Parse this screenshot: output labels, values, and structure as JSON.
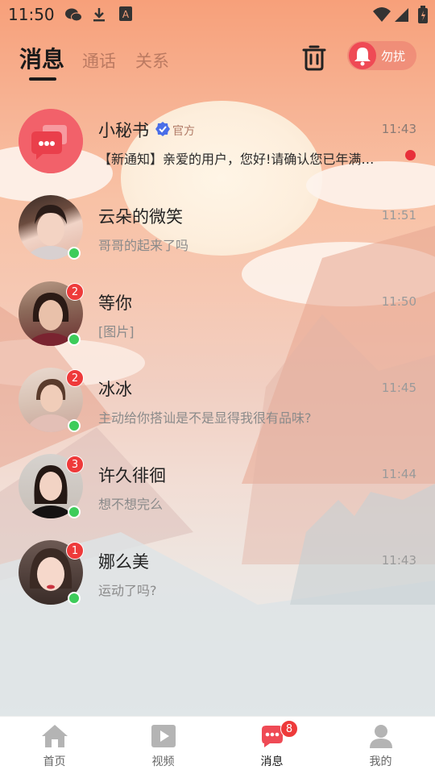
{
  "status_bar": {
    "time": "11:50",
    "icons": [
      "wechat-icon",
      "download-icon",
      "a-icon",
      "wifi-icon",
      "signal-icon",
      "battery-icon"
    ]
  },
  "header": {
    "tabs": [
      {
        "label": "消息",
        "active": true
      },
      {
        "label": "通话",
        "active": false
      },
      {
        "label": "关系",
        "active": false
      }
    ],
    "dnd_label": "勿扰"
  },
  "conversations": [
    {
      "name": "小秘书",
      "verified": true,
      "tag": "官方",
      "time": "11:43",
      "preview": "【新通知】亲爱的用户，您好!请确认您已年满…",
      "unread_dot": true,
      "badge": null,
      "online": false
    },
    {
      "name": "云朵的微笑",
      "time": "11:51",
      "preview": "哥哥的起来了吗",
      "badge": null,
      "online": true
    },
    {
      "name": "等你",
      "time": "11:50",
      "preview": "[图片]",
      "badge": "2",
      "online": true
    },
    {
      "name": "冰冰",
      "time": "11:45",
      "preview": "主动给你搭讪是不是显得我很有品味?",
      "badge": "2",
      "online": true
    },
    {
      "name": "许久徘徊",
      "time": "11:44",
      "preview": "想不想完么",
      "badge": "3",
      "online": true
    },
    {
      "name": "娜么美",
      "time": "11:43",
      "preview": "运动了吗?",
      "badge": "1",
      "online": true
    }
  ],
  "bottom_nav": [
    {
      "label": "首页",
      "icon": "home-icon"
    },
    {
      "label": "视频",
      "icon": "video-icon"
    },
    {
      "label": "消息",
      "icon": "message-icon",
      "active": true,
      "badge": "8"
    },
    {
      "label": "我的",
      "icon": "profile-icon"
    }
  ],
  "colors": {
    "accent": "#ef4a55",
    "badge": "#ee3a3a",
    "online": "#3dcc5a"
  }
}
